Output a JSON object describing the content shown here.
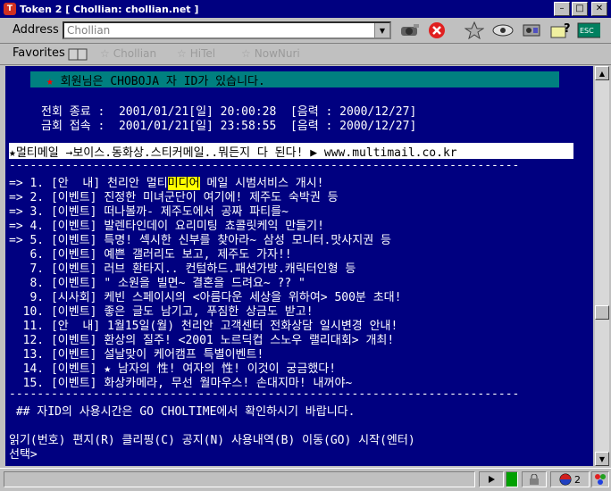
{
  "window": {
    "title": "Token 2 [ Chollian: chollian.net ]",
    "app_icon": "token-app-icon"
  },
  "address_bar": {
    "label": "Address",
    "value": "Chollian"
  },
  "favorites_bar": {
    "label": "Favorites",
    "items": [
      {
        "label": "Chollian"
      },
      {
        "label": "HiTel"
      },
      {
        "label": "NowNuri"
      }
    ]
  },
  "terminal": {
    "notice": "회원님은 CHOBOJA  자 ID가 있습니다.",
    "conn1": "전회 종료 :  2001/01/21[일] 20:00:28  [음력 : 2000/12/27]",
    "conn2": "금회 접속 :  2001/01/21[일] 23:58:55  [음력 : 2000/12/27]",
    "banner": "★멀티메일 →보이스.동화상.스티커메일..뭐든지 다 된다! ▶ www.multimail.co.kr",
    "separator": "-------------------------------------------------------------------------",
    "menu": [
      {
        "prefix": "=> 1.",
        "cat": "[안  내]",
        "pre": "천리안 멀티",
        "hl": "미디어",
        "post": " 메일 시범서비스 개시!"
      },
      {
        "prefix": "=> 2.",
        "cat": "[이벤트]",
        "text": "진정한 미녀군단이 여기에! 제주도 숙박권 등"
      },
      {
        "prefix": "=> 3.",
        "cat": "[이벤트]",
        "text": "떠나볼까- 제주도에서 공짜 파티를~"
      },
      {
        "prefix": "=> 4.",
        "cat": "[이벤트]",
        "text": "발렌타인데이 요리미팅 쵸콜릿케익 만들기!"
      },
      {
        "prefix": "=> 5.",
        "cat": "[이벤트]",
        "text": "특명! 섹시한 신부를 찾아라~ 삼성 모니터.맛사지권 등"
      },
      {
        "prefix": "   6.",
        "cat": "[이벤트]",
        "text": "예쁜 갤러리도 보고, 제주도 가자!!"
      },
      {
        "prefix": "   7.",
        "cat": "[이벤트]",
        "text": "러브 환타지.. 컨텀하드.패션가방.캐릭터인형 등"
      },
      {
        "prefix": "   8.",
        "cat": "[이벤트]",
        "text": "\" 소원을 빌면~ 결혼을 드려요~ ?? \""
      },
      {
        "prefix": "   9.",
        "cat": "[시사회]",
        "text": "케빈 스페이시의 <아름다운 세상을 위하여> 500분 초대!"
      },
      {
        "prefix": "  10.",
        "cat": "[이벤트]",
        "text": "좋은 글도 남기고, 푸짐한 상금도 받고!"
      },
      {
        "prefix": "  11.",
        "cat": "[안  내]",
        "text": "1월15일(월) 천리안 고객센터 전화상담 일시변경 안내!"
      },
      {
        "prefix": "  12.",
        "cat": "[이벤트]",
        "text": "환상의 질주! <2001 노르딕컵 스노우 랠리대회> 개최!"
      },
      {
        "prefix": "  13.",
        "cat": "[이벤트]",
        "text": "설날맞이 케어캠프 특별이벤트!"
      },
      {
        "prefix": "  14.",
        "cat": "[이벤트]",
        "text": "★ 남자의 性! 여자의 性! 이것이 궁금했다!"
      },
      {
        "prefix": "  15.",
        "cat": "[이벤트]",
        "text": "화상카메라, 무선 월마우스! 손대지마! 내꺼야~"
      }
    ],
    "hint": " ## 자ID의 사용시간은 GO CHOLTIME에서 확인하시기 바랍니다.",
    "commands": "읽기(번호) 편지(R) 클리핑(C) 공지(N) 사용내역(B) 이동(GO) 시작(엔터)",
    "prompt": "선택>"
  },
  "status": {
    "zoom": "2"
  },
  "colors": {
    "terminal_bg": "#000080",
    "notice_bg": "#008080",
    "title_bg": "#000080",
    "highlight": "#ffff00"
  }
}
